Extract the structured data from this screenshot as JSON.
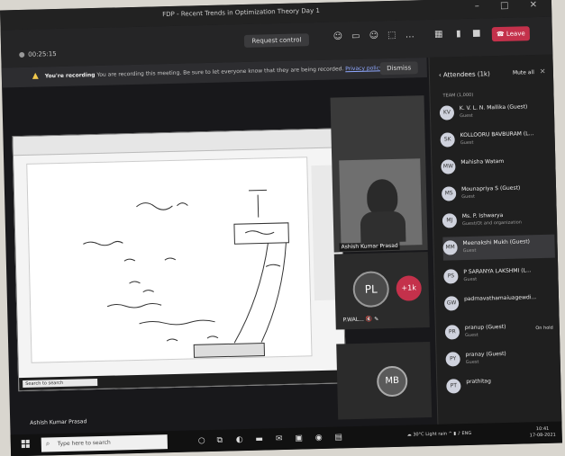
{
  "window": {
    "title": "FDP - Recent Trends in Optimization Theory Day 1",
    "controls": [
      "–",
      "□",
      "✕"
    ]
  },
  "toolbar": {
    "timer": "00:25:15",
    "request_control": "Request control",
    "leave": "Leave",
    "icons": [
      "people-icon",
      "chat-icon",
      "reactions-icon",
      "share-icon",
      "more-icon",
      "rooms-icon",
      "camera-icon",
      "mic-icon"
    ]
  },
  "banner": {
    "strong": "You're recording",
    "text": "You are recording this meeting. Be sure to let everyone know that they are being recorded.",
    "link": "Privacy policy",
    "dismiss": "Dismiss"
  },
  "video": {
    "camera_name": "Ashish Kumar Prasad",
    "tiles": [
      {
        "initials": "PL",
        "label": "P.WAL... 🔇 ✎"
      },
      {
        "initials": "+1k",
        "label": ""
      },
      {
        "initials": "MB",
        "label": ""
      }
    ]
  },
  "attendees": {
    "header": "Attendees (1k)",
    "mute_all": "Mute all",
    "section": "TEAM (1,000)",
    "list": [
      {
        "initials": "KV",
        "name": "K. V. L. N. Mallika (Guest)",
        "role": "Guest",
        "status": ""
      },
      {
        "initials": "SK",
        "name": "KOLLOORU BAVBURAM (L...",
        "role": "Guest",
        "status": ""
      },
      {
        "initials": "MW",
        "name": "Mahisha Watam",
        "role": "",
        "status": ""
      },
      {
        "initials": "MS",
        "name": "Mounapriya S (Guest)",
        "role": "Guest",
        "status": ""
      },
      {
        "initials": "MJ",
        "name": "Ms. P. Ishwarya",
        "role": "Guest/Ot and organization",
        "status": ""
      },
      {
        "initials": "MM",
        "name": "Meenakshi Mukh (Guest)",
        "role": "Guest",
        "status": ""
      },
      {
        "initials": "PS",
        "name": "P SARANYA LAKSHMI (L...",
        "role": "Guest",
        "status": ""
      },
      {
        "initials": "GW",
        "name": "padmavathamaiuagewdi...",
        "role": "",
        "status": ""
      },
      {
        "initials": "PR",
        "name": "pranup (Guest)",
        "role": "Guest",
        "status": "On hold"
      },
      {
        "initials": "PY",
        "name": "pranay (Guest)",
        "role": "Guest",
        "status": ""
      },
      {
        "initials": "PT",
        "name": "prathitag",
        "role": "",
        "status": ""
      }
    ]
  },
  "shared_screen": {
    "search_placeholder": "Search to search"
  },
  "presenter": "Ashish Kumar Prasad",
  "taskbar": {
    "search_placeholder": "Type here to search",
    "weather": "30°C Light rain",
    "time": "10:41",
    "date": "17-08-2021"
  }
}
